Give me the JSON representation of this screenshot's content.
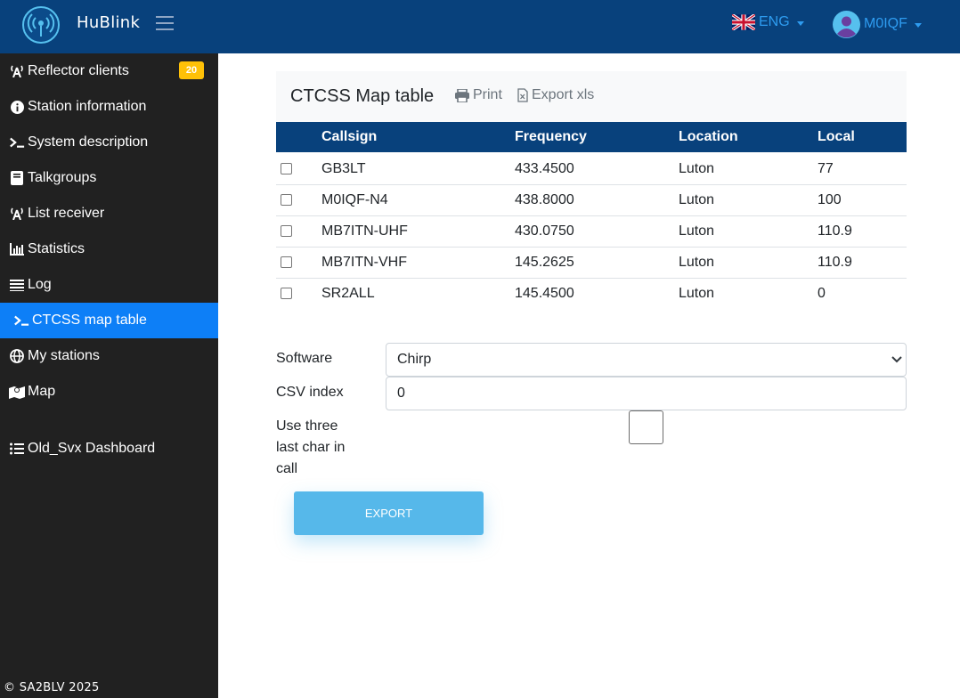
{
  "header": {
    "brand": "HuBlink",
    "language": "ENG",
    "user": "M0IQF"
  },
  "sidebar": {
    "items": [
      {
        "label": "Reflector clients",
        "icon": "antenna-icon",
        "badge": "20"
      },
      {
        "label": "Station information",
        "icon": "info-icon"
      },
      {
        "label": "System description",
        "icon": "terminal-icon"
      },
      {
        "label": "Talkgroups",
        "icon": "book-icon"
      },
      {
        "label": "List receiver",
        "icon": "antenna-icon"
      },
      {
        "label": "Statistics",
        "icon": "bar-chart-icon"
      },
      {
        "label": "Log",
        "icon": "list-icon"
      },
      {
        "label": "CTCSS map table",
        "icon": "terminal-icon",
        "active": true
      },
      {
        "label": "My stations",
        "icon": "globe-icon"
      },
      {
        "label": "Map",
        "icon": "map-icon"
      },
      {
        "label": "Old_Svx Dashboard",
        "icon": "list-ul-icon"
      }
    ],
    "footer": "© SA2BLV 2025"
  },
  "card": {
    "title": "CTCSS Map table",
    "print_label": "Print",
    "export_xls_label": "Export xls"
  },
  "table": {
    "columns": [
      "Callsign",
      "Frequency",
      "Location",
      "Local"
    ],
    "rows": [
      {
        "callsign": "GB3LT",
        "frequency": "433.4500",
        "location": "Luton",
        "local": "77"
      },
      {
        "callsign": "M0IQF-N4",
        "frequency": "438.8000",
        "location": "Luton",
        "local": "100"
      },
      {
        "callsign": "MB7ITN-UHF",
        "frequency": "430.0750",
        "location": "Luton",
        "local": "110.9"
      },
      {
        "callsign": "MB7ITN-VHF",
        "frequency": "145.2625",
        "location": "Luton",
        "local": "110.9"
      },
      {
        "callsign": "SR2ALL",
        "frequency": "145.4500",
        "location": "Luton",
        "local": "0"
      }
    ]
  },
  "form": {
    "software_label": "Software",
    "software_value": "Chirp",
    "csv_index_label": "CSV index",
    "csv_index_value": "0",
    "three_char_label_line1": "Use three",
    "three_char_label_line2": "last char in",
    "three_char_label_line3": "call",
    "export_button": "EXPORT"
  },
  "colors": {
    "navbar": "#08417c",
    "sidebar": "#212121",
    "active": "#0d7ff7",
    "badge": "#ffc107",
    "export_button": "#56b8ea"
  }
}
